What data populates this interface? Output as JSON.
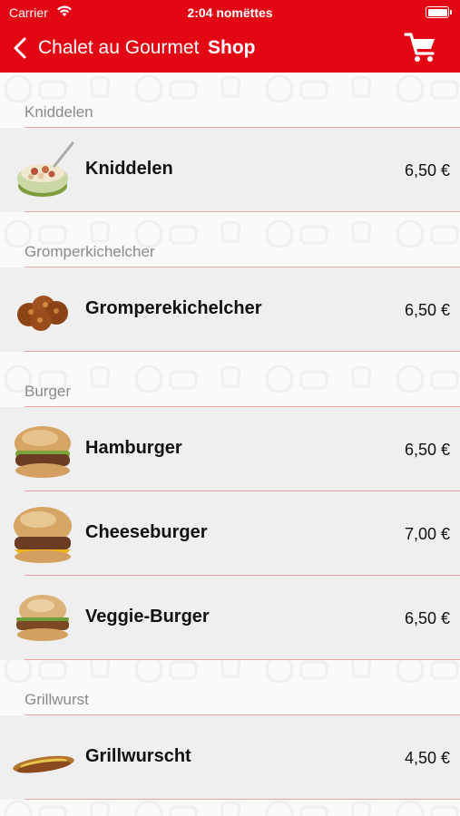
{
  "status_bar": {
    "carrier": "Carrier",
    "time": "2:04 nomëttes"
  },
  "nav": {
    "back_label": "Chalet au Gourmet",
    "title": "Shop",
    "cart_icon": "shopping-cart-icon"
  },
  "colors": {
    "brand_red": "#e30613",
    "separator": "#f2a2a2",
    "section_text": "#8a8a8a",
    "row_bg": "#efefef"
  },
  "sections": [
    {
      "title": "Kniddelen",
      "items": [
        {
          "name": "Kniddelen",
          "price": "6,50 €",
          "image": "kniddelen-photo"
        }
      ]
    },
    {
      "title": "Gromperkichelcher",
      "items": [
        {
          "name": "Gromperekichelcher",
          "price": "6,50 €",
          "image": "gromperekichelcher-photo"
        }
      ]
    },
    {
      "title": "Burger",
      "items": [
        {
          "name": "Hamburger",
          "price": "6,50 €",
          "image": "hamburger-photo"
        },
        {
          "name": "Cheeseburger",
          "price": "7,00 €",
          "image": "cheeseburger-photo"
        },
        {
          "name": "Veggie-Burger",
          "price": "6,50 €",
          "image": "veggie-burger-photo"
        }
      ]
    },
    {
      "title": "Grillwurst",
      "items": [
        {
          "name": "Grillwurscht",
          "price": "4,50 €",
          "image": "grillwurscht-photo"
        }
      ]
    }
  ]
}
